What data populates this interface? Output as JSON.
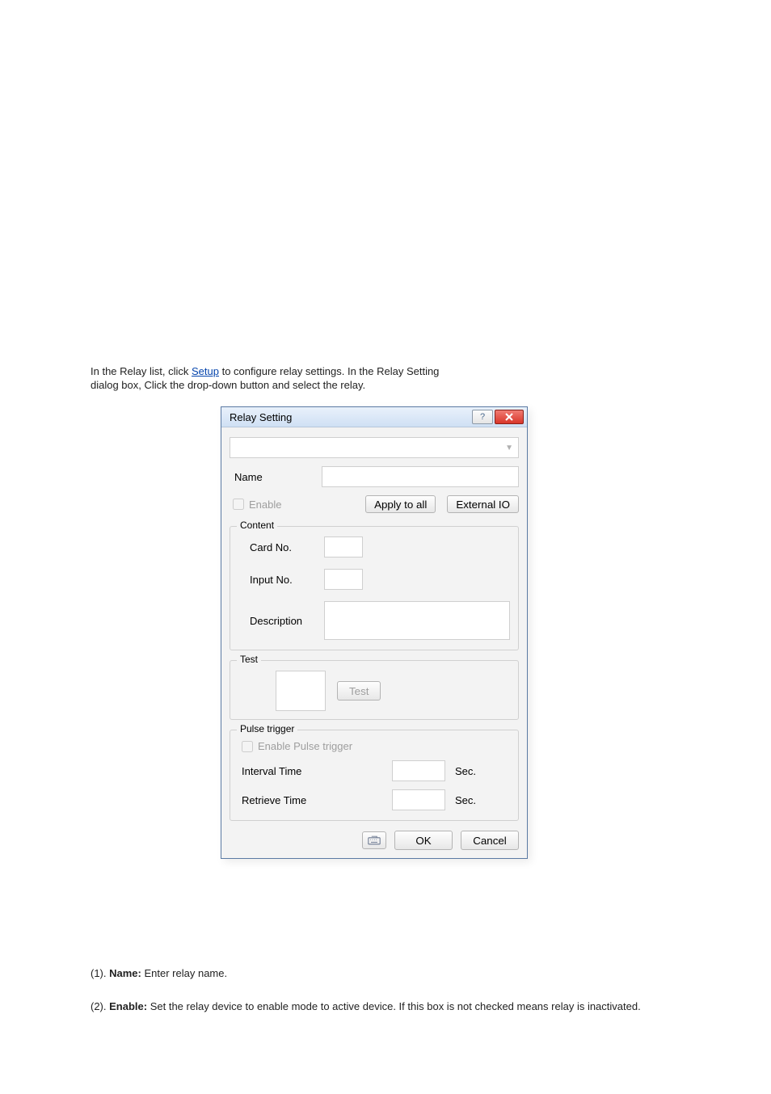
{
  "intro": {
    "line1": "In the Relay list, click ",
    "link": "Setup",
    "line2": " to configure relay settings. In the Relay Setting",
    "line3": "dialog box, Click the drop-down button and select the relay."
  },
  "dialog": {
    "title": "Relay Setting",
    "name_label": "Name",
    "enable_label": "Enable",
    "apply_button": "Apply to all",
    "external_button": "External IO",
    "content": {
      "legend": "Content",
      "card_no": "Card No.",
      "input_no": "Input No.",
      "description": "Description"
    },
    "test": {
      "legend": "Test",
      "button": "Test"
    },
    "pulse": {
      "legend": "Pulse trigger",
      "enable_label": "Enable Pulse trigger",
      "interval_label": "Interval Time",
      "retrieve_label": "Retrieve Time",
      "sec": "Sec."
    },
    "footer": {
      "ok": "OK",
      "cancel": "Cancel"
    }
  },
  "notes": {
    "n1_a": "(1).",
    "n1_b": "Name:",
    "n1_c": " Enter relay name.",
    "n2_a": "(2).",
    "n2_b": "Enable:",
    "n2_c": " Set the relay device to enable mode to active device. If this box is not checked means relay is inactivated."
  }
}
